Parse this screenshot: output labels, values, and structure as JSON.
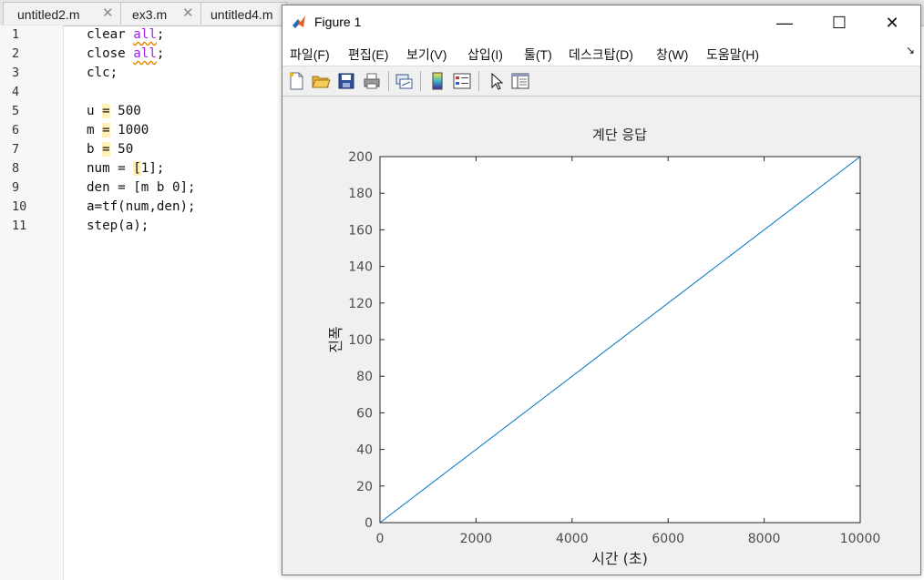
{
  "editor": {
    "tabs": [
      {
        "label": "untitled2.m",
        "close": "✕"
      },
      {
        "label": "ex3.m",
        "close": "✕"
      },
      {
        "label": "untitled4.m",
        "close": ""
      }
    ],
    "line_numbers": [
      "1",
      "2",
      "3",
      "4",
      "5",
      "6",
      "7",
      "8",
      "9",
      "10",
      "11"
    ],
    "code": {
      "l1a": "clear ",
      "l1b": "all",
      "l1c": ";",
      "l2a": "close ",
      "l2b": "all",
      "l2c": ";",
      "l3": "clc;",
      "l5a": "u ",
      "l5b": "=",
      "l5c": " 500",
      "l6a": "m ",
      "l6b": "=",
      "l6c": " 1000",
      "l7a": "b ",
      "l7b": "=",
      "l7c": " 50",
      "l8a": "num = ",
      "l8b": "[",
      "l8c": "1];",
      "l9": "den = [m b 0];",
      "l10": "a=tf(num,den);",
      "l11": "step(a);"
    }
  },
  "figure": {
    "title": "Figure 1",
    "window_buttons": {
      "minimize": "—",
      "maximize": "☐",
      "close": "✕"
    },
    "menu": [
      "파일(F)",
      "편집(E)",
      "보기(V)",
      "삽입(I)",
      "툴(T)",
      "데스크탑(D)",
      "창(W)",
      "도움말(H)"
    ],
    "menu_arrow": "↘",
    "toolbar_icons": [
      "new-file-icon",
      "open-folder-icon",
      "save-icon",
      "print-icon",
      "link-plot-icon",
      "colorbar-icon",
      "legend-icon",
      "pointer-icon",
      "property-editor-icon"
    ]
  },
  "chart_data": {
    "type": "line",
    "title": "계단 응답",
    "xlabel": "시간 (초)",
    "ylabel": "진폭",
    "xlim": [
      0,
      10000
    ],
    "ylim": [
      0,
      200
    ],
    "xticks": [
      "0",
      "2000",
      "4000",
      "6000",
      "8000",
      "10000"
    ],
    "yticks": [
      "0",
      "20",
      "40",
      "60",
      "80",
      "100",
      "120",
      "140",
      "160",
      "180",
      "200"
    ],
    "grid": false,
    "series": [
      {
        "color": "#0072bd",
        "x": [
          0,
          10000
        ],
        "y": [
          0,
          200
        ]
      }
    ]
  }
}
